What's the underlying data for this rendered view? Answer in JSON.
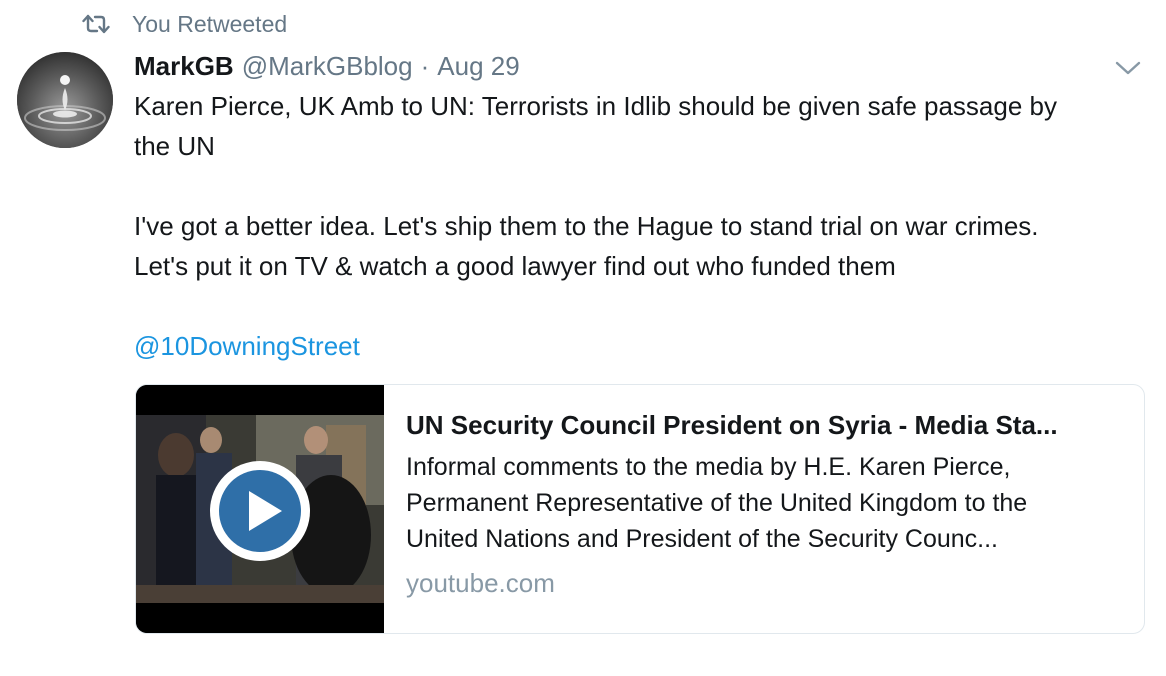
{
  "retweet_context": {
    "label": "You Retweeted",
    "icon": "retweet-icon"
  },
  "tweet": {
    "avatar": "water-drop-avatar",
    "fullname": "MarkGB",
    "username": "@MarkGBblog",
    "separator": "·",
    "timestamp": "Aug 29",
    "menu_icon": "chevron-down-icon",
    "text_lines": [
      "Karen Pierce, UK Amb to UN: Terrorists in Idlib should be given safe passage by",
      "the UN",
      "I've got a better idea. Let's ship them to the Hague to stand trial on war crimes.",
      "Let's put it on TV & watch a good lawyer find out who funded them"
    ],
    "mention": "@10DowningStreet"
  },
  "card": {
    "title": "UN Security Council President on Syria - Media Sta...",
    "description_lines": [
      "Informal comments to the media by H.E. Karen Pierce,",
      "Permanent Representative of the United Kingdom to the",
      "United Nations and President of the Security Counc..."
    ],
    "domain": "youtube.com",
    "play_icon": "play-icon"
  },
  "colors": {
    "text": "#14171a",
    "secondary": "#657786",
    "link": "#1b95e0",
    "card_border": "#e1e8ed",
    "play_button": "#2f6fa8"
  }
}
